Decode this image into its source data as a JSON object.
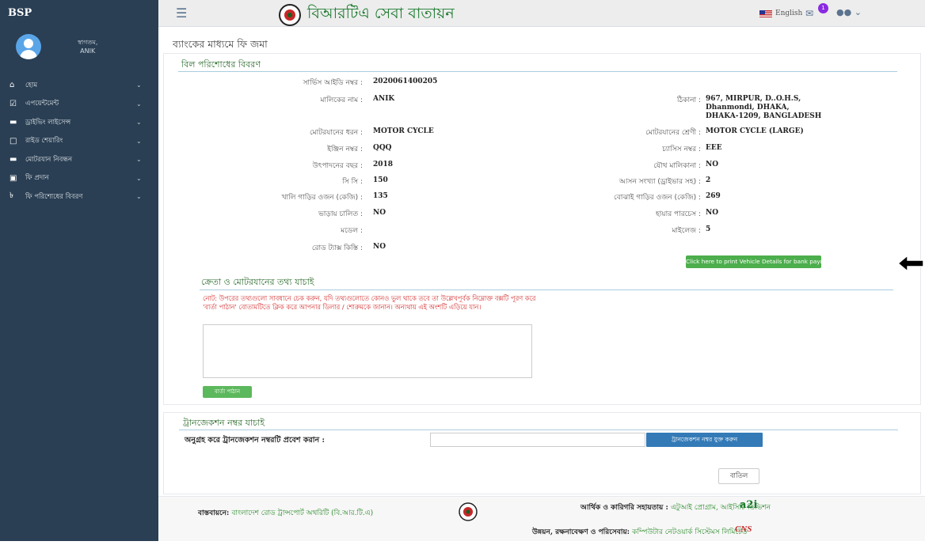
{
  "sidebar": {
    "brand": "BSP",
    "profile": {
      "greeting": "স্বাগতম,",
      "name": "ANIK"
    },
    "items": [
      {
        "icon": "home-icon",
        "glyph": "⌂",
        "label": "হোম"
      },
      {
        "icon": "appointment-icon",
        "glyph": "☑",
        "label": "এপয়েন্টমেন্ট"
      },
      {
        "icon": "car-icon",
        "glyph": "▬",
        "label": "ড্রাইভিং লাইসেন্স"
      },
      {
        "icon": "ride-share-icon",
        "glyph": "□",
        "label": "রাইড শেয়ারিং"
      },
      {
        "icon": "vehicle-icon",
        "glyph": "▬",
        "label": "মোটরযান নিবন্ধন"
      },
      {
        "icon": "fee-icon",
        "glyph": "▣",
        "label": "ফি প্রদান"
      },
      {
        "icon": "payment-details-icon",
        "glyph": "৳",
        "label": "ফি পরিশোধের বিবরণ"
      }
    ]
  },
  "topbar": {
    "title": "বিআরটিএ সেবা বাতায়ন",
    "language": "English",
    "notification_count": "1"
  },
  "page": {
    "title": "ব্যাংকের মাধ্যমে ফি জমা",
    "bill_section_title": "বিল পরিশোধের বিবরণ"
  },
  "bill": {
    "service_id": {
      "label": "সার্ভিস আইডি নম্বর :",
      "value": "2020061400205"
    },
    "owner_name": {
      "label": "মালিকের নাম :",
      "value": "ANIK"
    },
    "address": {
      "label": "ঠিকানা :",
      "lines": [
        "967, MIRPUR, D..O.H.S,",
        "Dhanmondi, DHAKA,",
        "DHAKA-1209, BANGLADESH"
      ]
    },
    "vehicle_type": {
      "label": "মোটরযানের ধরন :",
      "value": "MOTOR CYCLE"
    },
    "vehicle_class": {
      "label": "মোটরযানের শ্রেণী :",
      "value": "MOTOR CYCLE (LARGE)"
    },
    "engine_no": {
      "label": "ইঞ্জিন নম্বর :",
      "value": "QQQ"
    },
    "chassis_no": {
      "label": "চ্যাসিস নম্বর :",
      "value": "EEE"
    },
    "manufacture_year": {
      "label": "উৎপাদনের বছর :",
      "value": "2018"
    },
    "joint_ownership": {
      "label": "যৌথ মালিকানা :",
      "value": "NO"
    },
    "cc": {
      "label": "সি সি :",
      "value": "150"
    },
    "seats": {
      "label": "আসন সংখ্যা (ড্রাইভার সহ) :",
      "value": "2"
    },
    "unladen_weight": {
      "label": "খালি গাড়ির ওজন (কেজি) :",
      "value": "135"
    },
    "laden_weight": {
      "label": "বোঝাই গাড়ির ওজন (কেজি) :",
      "value": "269"
    },
    "hire": {
      "label": "ভাড়ায় চালিত :",
      "value": "NO"
    },
    "hire_purchase": {
      "label": "হায়ার পারচেস :",
      "value": "NO"
    },
    "model": {
      "label": "মডেল :",
      "value": ""
    },
    "mileage": {
      "label": "মাইলেজ :",
      "value": "5"
    },
    "road_tax": {
      "label": "রোড ট্যাক্স কিস্তি :",
      "value": "NO"
    }
  },
  "actions": {
    "print_button": "Click here to print Vehicle Details for bank payment",
    "verify_title": "ক্রেতা ও মোটরযানের তথ্য যাচাই",
    "note": "নোট: উপরের তথ্যগুলো সাবধানে চেক করুন, যদি তথ্যগুলোতে কোনও ভুল থাকে তবে তা উল্লেখপূর্বক নিম্নোক্ত বক্সটি পূরণ করে 'বার্তা পাঠান' বোতামটিতে ক্লিক করে আপনার ডিলার / শোরুমকে জানান। অন্যথায় এই অংশটি এড়িয়ে যান।",
    "message_value": "",
    "send_button": "বার্তা পাঠান"
  },
  "transaction": {
    "title": "ট্রানজেকশন নম্বর যাচাই",
    "prompt": "অনুগ্রহ করে ট্রানজেকশন নম্বরটি প্রবেশ করান :",
    "input_value": "",
    "add_button": "ট্রানজেকশন নম্বর যুক্ত করুন",
    "cancel_button": "বাতিল"
  },
  "footer": {
    "impl_label": "বাস্তবায়নে:",
    "impl_value": "বাংলাদেশ রোড ট্রান্সপোর্ট অথরিটি (বি.আর.টি.এ)",
    "support_label": "আর্থিক ও কারিগরি সহায়তায় :",
    "support_value": "এটুআই প্রোগ্রাম, আইসিটি ডিভিশন",
    "dev_label": "উন্নয়ন, রক্ষনাবেক্ষণ ও পরিসেবায়:",
    "dev_value": "কম্পিউটার নেটওয়ার্ক সিস্টেমস লিমিটেড",
    "a2i_logo": "a2i",
    "cns_logo": "CNS"
  }
}
